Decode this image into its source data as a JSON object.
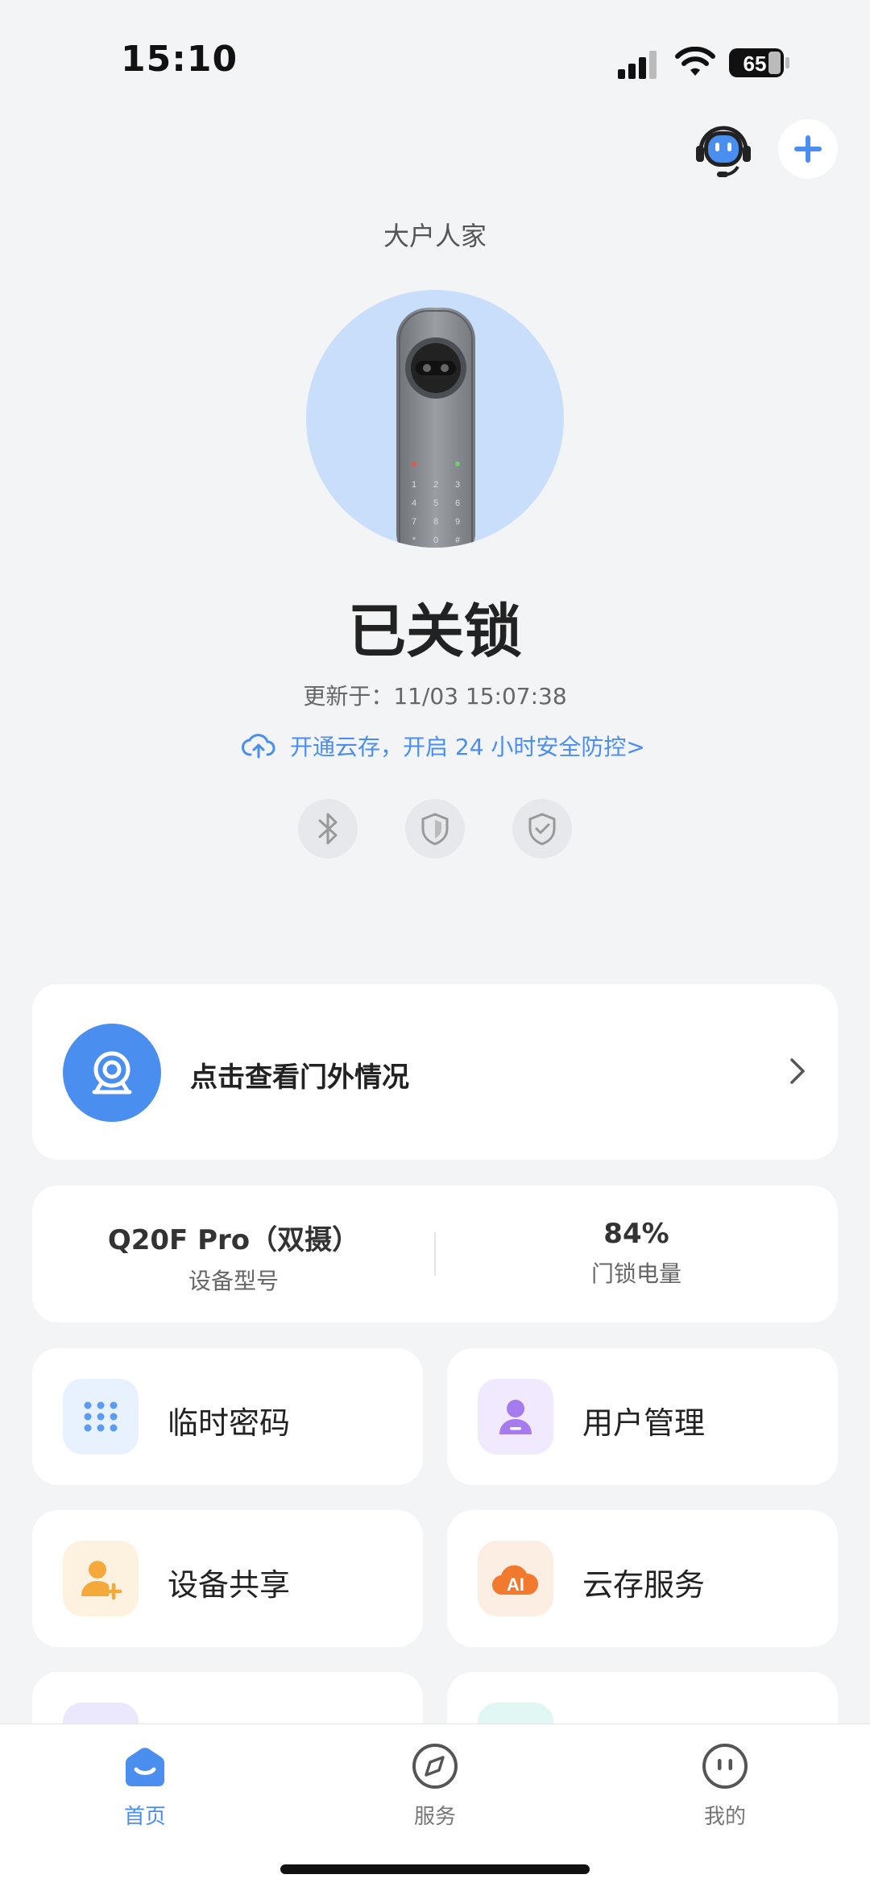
{
  "status_bar": {
    "time": "15:10",
    "battery": "65"
  },
  "header": {
    "home_name": "大户人家"
  },
  "lock": {
    "status": "已关锁",
    "updated_label": "更新于：",
    "updated_time": "11/03 15:07:38",
    "cloud_promo": "开通云存，开启 24 小时安全防控>"
  },
  "camera_card": {
    "label": "点击查看门外情况"
  },
  "device_info": {
    "model_value": "Q20F Pro（双摄）",
    "model_label": "设备型号",
    "battery_value": "84%",
    "battery_label": "门锁电量"
  },
  "tiles": [
    {
      "label": "临时密码",
      "icon": "keypad-icon"
    },
    {
      "label": "用户管理",
      "icon": "user-icon"
    },
    {
      "label": "设备共享",
      "icon": "add-user-icon"
    },
    {
      "label": "云存服务",
      "icon": "ai-cloud-icon"
    }
  ],
  "tabs": [
    {
      "label": "首页",
      "active": true
    },
    {
      "label": "服务",
      "active": false
    },
    {
      "label": "我的",
      "active": false
    }
  ],
  "colors": {
    "accent": "#4a8ef0",
    "background": "#f3f4f6",
    "lock_circle": "#c9defb"
  }
}
